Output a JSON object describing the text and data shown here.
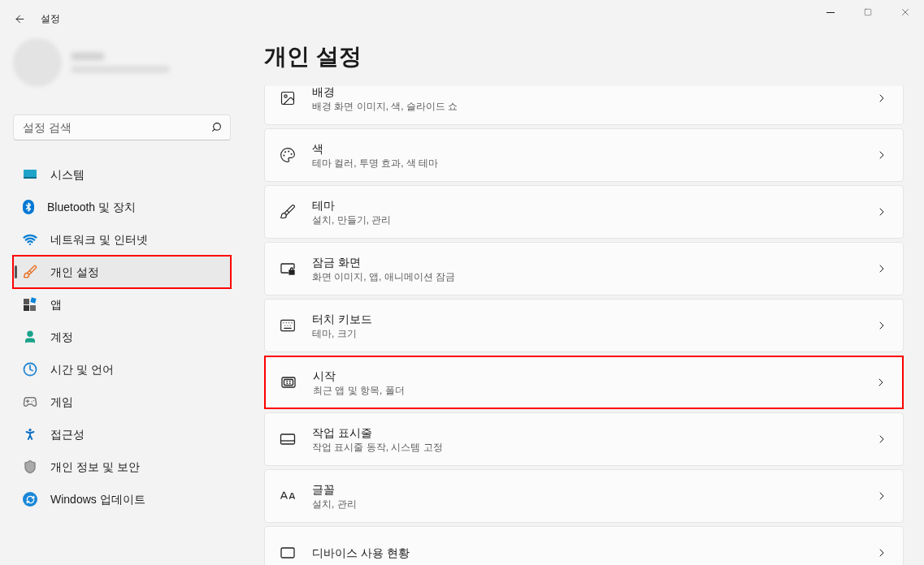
{
  "window": {
    "title": "설정"
  },
  "sidebar": {
    "search": {
      "placeholder": "설정 검색"
    },
    "items": [
      {
        "kind": "system",
        "label": "시스템",
        "selected": false,
        "highlighted": false
      },
      {
        "kind": "bluetooth",
        "label": "Bluetooth 및 장치",
        "selected": false,
        "highlighted": false
      },
      {
        "kind": "network",
        "label": "네트워크 및 인터넷",
        "selected": false,
        "highlighted": false
      },
      {
        "kind": "personalize",
        "label": "개인 설정",
        "selected": true,
        "highlighted": true
      },
      {
        "kind": "apps",
        "label": "앱",
        "selected": false,
        "highlighted": false
      },
      {
        "kind": "account",
        "label": "계정",
        "selected": false,
        "highlighted": false
      },
      {
        "kind": "time",
        "label": "시간 및 언어",
        "selected": false,
        "highlighted": false
      },
      {
        "kind": "gaming",
        "label": "게임",
        "selected": false,
        "highlighted": false
      },
      {
        "kind": "accessibility",
        "label": "접근성",
        "selected": false,
        "highlighted": false
      },
      {
        "kind": "privacy",
        "label": "개인 정보 및 보안",
        "selected": false,
        "highlighted": false
      },
      {
        "kind": "update",
        "label": "Windows 업데이트",
        "selected": false,
        "highlighted": false
      }
    ]
  },
  "page": {
    "title": "개인 설정",
    "cards": [
      {
        "kind": "image",
        "title": "배경",
        "subtitle": "배경 화면 이미지, 색, 슬라이드 쇼",
        "highlighted": false
      },
      {
        "kind": "palette",
        "title": "색",
        "subtitle": "테마 컬러, 투명 효과, 색 테마",
        "highlighted": false
      },
      {
        "kind": "brush",
        "title": "테마",
        "subtitle": "설치, 만들기, 관리",
        "highlighted": false
      },
      {
        "kind": "lock",
        "title": "잠금 화면",
        "subtitle": "화면 이미지, 앱, 애니메이션 잠금",
        "highlighted": false
      },
      {
        "kind": "keyboard",
        "title": "터치 키보드",
        "subtitle": "테마, 크기",
        "highlighted": false
      },
      {
        "kind": "start",
        "title": "시작",
        "subtitle": "최근 앱 및 항목, 폴더",
        "highlighted": true
      },
      {
        "kind": "taskbar",
        "title": "작업 표시줄",
        "subtitle": "작업 표시줄 동작, 시스템 고정",
        "highlighted": false
      },
      {
        "kind": "font",
        "title": "글꼴",
        "subtitle": "설치, 관리",
        "highlighted": false
      },
      {
        "kind": "device",
        "title": "디바이스 사용 현황",
        "highlighted": false
      }
    ]
  }
}
